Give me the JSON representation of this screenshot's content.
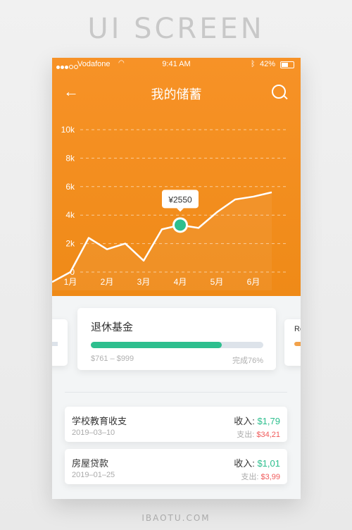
{
  "poster_title": "UI SCREEN",
  "footer_url": "IBAOTU.COM",
  "status_bar": {
    "carrier": "Vodafone",
    "time": "9:41 AM",
    "battery": "42%"
  },
  "nav": {
    "title": "我的储蓄"
  },
  "chart_data": {
    "type": "line",
    "x": [
      "",
      "1月",
      "",
      "2月",
      "",
      "3月",
      "",
      "4月",
      "",
      "5月",
      "",
      "6月",
      ""
    ],
    "categories": [
      "1月",
      "2月",
      "3月",
      "4月",
      "5月",
      "6月"
    ],
    "yticks": [
      "0",
      "2k",
      "4k",
      "6k",
      "8k",
      "10k"
    ],
    "ylim": [
      0,
      10000
    ],
    "series": [
      {
        "values": [
          -700,
          0,
          2400,
          1600,
          2000,
          800,
          3000,
          3300,
          3100,
          4200,
          5100,
          5300,
          5600
        ]
      }
    ],
    "highlight": {
      "index": 7,
      "label": "¥2550"
    },
    "grid": true
  },
  "goal_card": {
    "name": "退休基金",
    "range": "$761 – $999",
    "progress_label": "完成76%",
    "progress": 0.76
  },
  "side_card_right": {
    "label": "Re"
  },
  "transactions": [
    {
      "name": "学校教育收支",
      "date": "2019–03–10",
      "income_label": "收入:",
      "income_value": "$1,79",
      "expense_label": "支出:",
      "expense_value": "$34,21"
    },
    {
      "name": "房屋贷款",
      "date": "2019–01–25",
      "income_label": "收入:",
      "income_value": "$1,01",
      "expense_label": "支出:",
      "expense_value": "$3,99"
    }
  ],
  "colors": {
    "primary": "#f28d1c",
    "accent": "#2dbf8e",
    "expense": "#f05a5a"
  }
}
